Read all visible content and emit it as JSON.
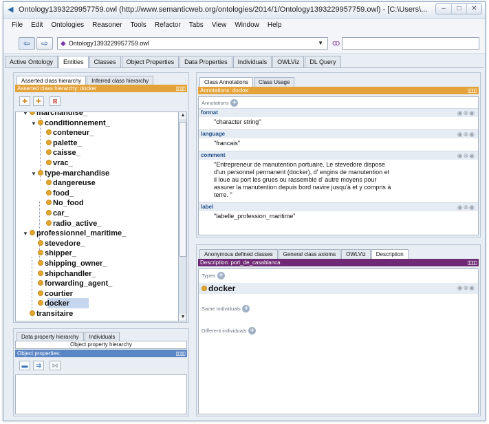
{
  "window": {
    "title": "Ontology1393229957759.owl (http://www.semanticweb.org/ontologies/2014/1/Ontology1393229957759.owl) - [C:\\Users\\...",
    "controls": [
      "–",
      "□",
      "✕"
    ]
  },
  "menu": [
    "File",
    "Edit",
    "Ontologies",
    "Reasoner",
    "Tools",
    "Refactor",
    "Tabs",
    "View",
    "Window",
    "Help"
  ],
  "toolbar": {
    "back_icon": "⇦",
    "forward_icon": "⇨",
    "ontology": "Ontology1393229957759.owl",
    "search_value": ""
  },
  "main_tabs": [
    "Active Ontology",
    "Entities",
    "Classes",
    "Object Properties",
    "Data Properties",
    "Individuals",
    "OWLViz",
    "DL Query"
  ],
  "left": {
    "hier_tabs": [
      "Asserted class hierarchy",
      "Inferred class hierarchy"
    ],
    "header": "Asserted class hierarchy: docker",
    "header_controls": "▯▯▯▯",
    "tree": [
      {
        "label": "marchandise_",
        "depth": 1,
        "arrow": "▼"
      },
      {
        "label": "conditionnement_",
        "depth": 2,
        "arrow": "▼"
      },
      {
        "label": "conteneur_",
        "depth": 3,
        "arrow": ""
      },
      {
        "label": "palette_",
        "depth": 3,
        "arrow": ""
      },
      {
        "label": "caisse_",
        "depth": 3,
        "arrow": ""
      },
      {
        "label": "vrac_",
        "depth": 3,
        "arrow": ""
      },
      {
        "label": "type-marchandise",
        "depth": 2,
        "arrow": "▼"
      },
      {
        "label": "dangereuse",
        "depth": 3,
        "arrow": ""
      },
      {
        "label": "food_",
        "depth": 3,
        "arrow": ""
      },
      {
        "label": "No_food",
        "depth": 3,
        "arrow": ""
      },
      {
        "label": "car_",
        "depth": 3,
        "arrow": ""
      },
      {
        "label": "radio_active_",
        "depth": 3,
        "arrow": ""
      },
      {
        "label": "professionnel_maritime_",
        "depth": 1,
        "arrow": "▼"
      },
      {
        "label": "stevedore_",
        "depth": 2,
        "arrow": ""
      },
      {
        "label": "shipper_",
        "depth": 2,
        "arrow": ""
      },
      {
        "label": "shipping_owner_",
        "depth": 2,
        "arrow": ""
      },
      {
        "label": "shipchandler_",
        "depth": 2,
        "arrow": ""
      },
      {
        "label": "forwarding_agent_",
        "depth": 2,
        "arrow": ""
      },
      {
        "label": "courtier",
        "depth": 2,
        "arrow": ""
      },
      {
        "label": "docker",
        "depth": 2,
        "arrow": ""
      },
      {
        "label": "transitaire",
        "depth": 1,
        "arrow": ""
      }
    ],
    "prop_tabs": [
      "Data property hierarchy",
      "Individuals"
    ],
    "prop_title": "Object property hierarchy",
    "prop_header": "Object properties:"
  },
  "annotations": {
    "tabs": [
      "Class Annotations",
      "Class Usage"
    ],
    "header": "Annotations: docker",
    "section_label": "Annotations",
    "items": [
      {
        "name": "format",
        "lines": [
          "\"character string\""
        ]
      },
      {
        "name": "language",
        "lines": [
          "\"francais\""
        ]
      },
      {
        "name": "comment",
        "lines": [
          "\"Entrepreneur de manutention portuaire. Le stevedore dispose",
          "d'un personnel permanent (docker), d' engins de manutention et",
          "il loue au port les grues ou rassemble d' autre moyens pour",
          "assurer la manutention depuis bord navire jusqu'à et y compris à",
          "terre. \""
        ]
      },
      {
        "name": "label",
        "lines": [
          "\"labelle_profession_maritime\""
        ]
      }
    ]
  },
  "description": {
    "tabs": [
      "Anonymous defined classes",
      "General class axioms",
      "OWLViz",
      "Description"
    ],
    "header": "Description: port_de_casablanca",
    "types_label": "Types",
    "type_value": "docker",
    "same_label": "Same individuals",
    "different_label": "Different individuals"
  }
}
